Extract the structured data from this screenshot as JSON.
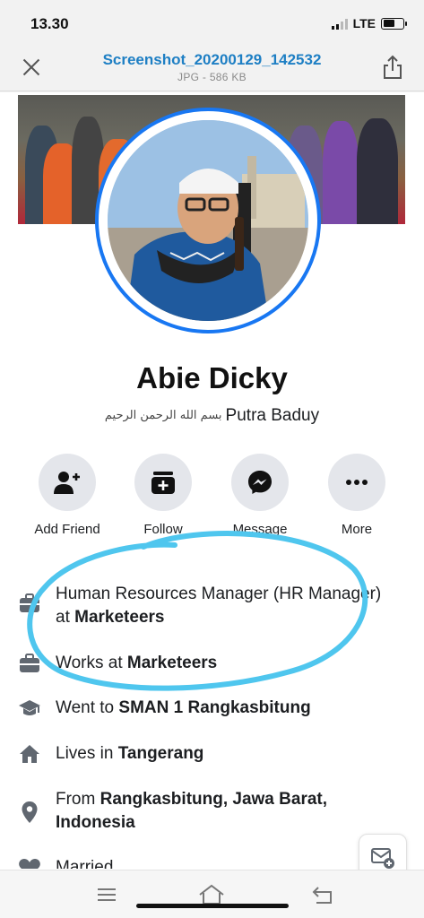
{
  "status_bar": {
    "time": "13.30",
    "network": "LTE",
    "icons": [
      "signal-icon",
      "battery-icon"
    ]
  },
  "file_header": {
    "filename": "Screenshot_20200129_142532",
    "meta": "JPG - 586 KB",
    "icons": [
      "close-icon",
      "share-icon"
    ],
    "accent": "#1e7fc4"
  },
  "profile": {
    "name": "Abie Dicky",
    "subtitle": "Putra Baduy",
    "subtitle_ornament": "بسم الله الرحمن الرحيم",
    "ring_color": "#1877f2"
  },
  "actions": [
    {
      "label": "Add Friend",
      "icon": "add-friend-icon"
    },
    {
      "label": "Follow",
      "icon": "follow-icon"
    },
    {
      "label": "Message",
      "icon": "messenger-icon"
    },
    {
      "label": "More",
      "icon": "more-icon"
    }
  ],
  "intro": [
    {
      "icon": "briefcase-icon",
      "prefix": "Human Resources Manager (HR Manager) at ",
      "bold": "Marketeers",
      "suffix": ""
    },
    {
      "icon": "briefcase-icon",
      "prefix": "Works at ",
      "bold": "Marketeers",
      "suffix": ""
    },
    {
      "icon": "graduation-cap-icon",
      "prefix": "Went to ",
      "bold": "SMAN 1 Rangkasbitung",
      "suffix": ""
    },
    {
      "icon": "home-icon",
      "prefix": "Lives in ",
      "bold": "Tangerang",
      "suffix": ""
    },
    {
      "icon": "location-pin-icon",
      "prefix": "From ",
      "bold": "Rangkasbitung, Jawa Barat, Indonesia",
      "suffix": ""
    },
    {
      "icon": "heart-icon",
      "prefix": "Married",
      "bold": "",
      "suffix": ""
    }
  ],
  "annotation_color": "#4fc6ee",
  "bottom_nav": {
    "icons": [
      "menu-icon",
      "home-outline-icon",
      "back-icon"
    ]
  },
  "floating_button": {
    "icon": "compose-message-icon"
  }
}
